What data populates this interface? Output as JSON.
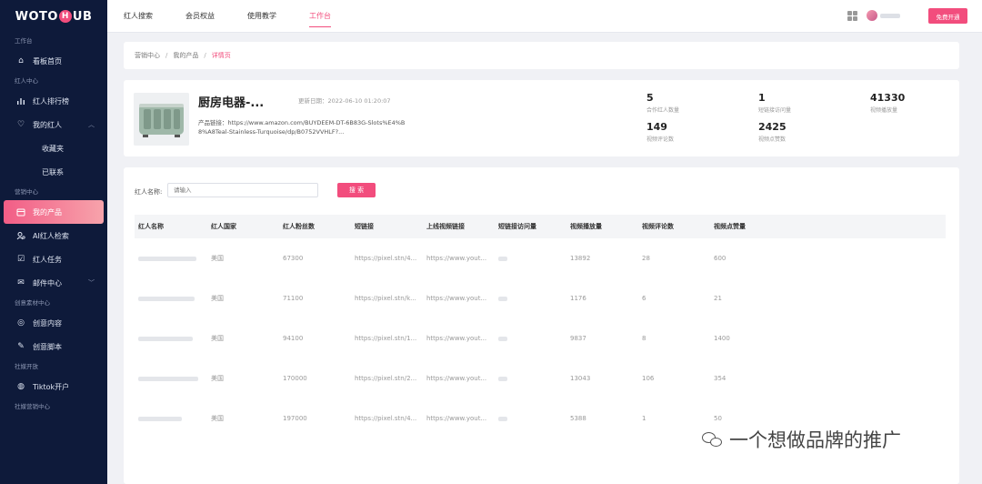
{
  "sidebar": {
    "logo_left": "WOTO",
    "logo_mid": "H",
    "logo_right": "UB",
    "sections": {
      "workspace": "工作台",
      "creator_center": "红人中心",
      "marketing_center": "营销中心",
      "creative_material": "创意素材中心",
      "social_open": "社媒开放",
      "social_marketing": "社媒营销中心"
    },
    "items": {
      "dashboard": "看板首页",
      "ranking": "红人排行榜",
      "my_creators": "我的红人",
      "favorites": "收藏夹",
      "contacted": "已联系",
      "my_products": "我的产品",
      "ai_search": "AI红人检索",
      "tasks": "红人任务",
      "mail": "邮件中心",
      "creative_content": "创意内容",
      "creative_script": "创意脚本",
      "tiktok": "Tiktok开户"
    }
  },
  "topbar": {
    "nav": [
      "红人搜索",
      "会员权益",
      "使用教学",
      "工作台"
    ],
    "upgrade_label": "免费开通"
  },
  "breadcrumb": {
    "items": [
      "营销中心",
      "我的产品",
      "详情页"
    ],
    "separator": "/"
  },
  "product": {
    "title": "厨房电器-...",
    "date_label": "更新日期：",
    "date_value": "2022-06-10 01:20:07",
    "link_label": "产品链接：",
    "link_value": "https://www.amazon.com/BUYDEEM-DT-6B83G-Slots%E4%B8%A8Teal-Stainless-Turquoise/dp/B0752VVHLF?...",
    "stats": [
      {
        "value": "5",
        "label": "合作红人数量"
      },
      {
        "value": "1",
        "label": "短链接访问量"
      },
      {
        "value": "41330",
        "label": "视频播放量"
      },
      {
        "value": "149",
        "label": "视频评论数"
      },
      {
        "value": "2425",
        "label": "视频点赞数"
      }
    ]
  },
  "search": {
    "label": "红人名称:",
    "placeholder": "请输入",
    "button": "搜 索"
  },
  "table": {
    "headers": [
      "红人名称",
      "红人国家",
      "红人粉丝数",
      "短链接",
      "上线视频链接",
      "短链接访问量",
      "视频播放量",
      "视频评论数",
      "视频点赞量"
    ],
    "rows": [
      {
        "country": "美国",
        "fans": "67300",
        "short": "https://pixel.stn/4...",
        "video": "https://www.yout...",
        "plays": "13892",
        "comments": "28",
        "likes": "600"
      },
      {
        "country": "美国",
        "fans": "71100",
        "short": "https://pixel.stn/k...",
        "video": "https://www.yout...",
        "plays": "1176",
        "comments": "6",
        "likes": "21"
      },
      {
        "country": "美国",
        "fans": "94100",
        "short": "https://pixel.stn/1...",
        "video": "https://www.yout...",
        "plays": "9837",
        "comments": "8",
        "likes": "1400"
      },
      {
        "country": "美国",
        "fans": "170000",
        "short": "https://pixel.stn/2...",
        "video": "https://www.yout...",
        "plays": "13043",
        "comments": "106",
        "likes": "354"
      },
      {
        "country": "美国",
        "fans": "197000",
        "short": "https://pixel.stn/4...",
        "video": "https://www.yout...",
        "plays": "5388",
        "comments": "1",
        "likes": "50"
      }
    ]
  },
  "watermark": "一个想做品牌的推广",
  "colors": {
    "accent": "#f24d7d",
    "sidebar": "#0e1a3a"
  }
}
